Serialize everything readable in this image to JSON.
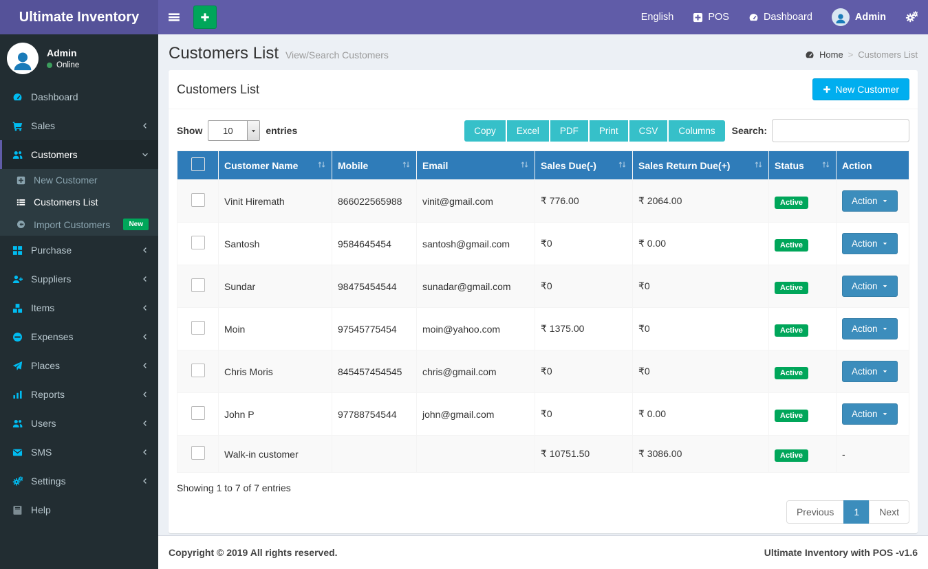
{
  "colors": {
    "navbar": "#605ca8",
    "brand_bg": "#555299",
    "sidebar": "#222d32",
    "icon_accent": "#00bcf1",
    "table_header": "#2f7cb9",
    "success_green": "#00a65a",
    "export_teal": "#36c0c9",
    "primary_blue": "#3c8dbc",
    "new_button_blue": "#00aeef",
    "page_bg": "#ecf0f5"
  },
  "navbar": {
    "brand": "Ultimate Inventory",
    "links": [
      {
        "label": "English",
        "icon": null
      },
      {
        "label": "POS",
        "icon": "plus-square"
      },
      {
        "label": "Dashboard",
        "icon": "tachometer"
      }
    ],
    "user": {
      "name": "Admin",
      "icon": "user"
    },
    "gear_icon": "cogs"
  },
  "sidebar": {
    "user": {
      "name": "Admin",
      "status": "Online"
    },
    "items": [
      {
        "label": "Dashboard",
        "icon": "tachometer"
      },
      {
        "label": "Sales",
        "icon": "cart",
        "arrow": "left"
      },
      {
        "label": "Customers",
        "icon": "users",
        "arrow": "down",
        "active": true,
        "submenu": [
          {
            "label": "New Customer",
            "icon": "plus-square"
          },
          {
            "label": "Customers List",
            "icon": "list",
            "active": true
          },
          {
            "label": "Import Customers",
            "icon": "arrow-circle-left",
            "badge": "New"
          }
        ]
      },
      {
        "label": "Purchase",
        "icon": "th-large",
        "arrow": "left"
      },
      {
        "label": "Suppliers",
        "icon": "user-plus",
        "arrow": "left"
      },
      {
        "label": "Items",
        "icon": "cubes",
        "arrow": "left"
      },
      {
        "label": "Expenses",
        "icon": "minus-circle",
        "arrow": "left"
      },
      {
        "label": "Places",
        "icon": "paper-plane",
        "arrow": "left"
      },
      {
        "label": "Reports",
        "icon": "bar-chart",
        "arrow": "left"
      },
      {
        "label": "Users",
        "icon": "users",
        "arrow": "left"
      },
      {
        "label": "SMS",
        "icon": "envelope",
        "arrow": "left"
      },
      {
        "label": "Settings",
        "icon": "cogs",
        "arrow": "left"
      },
      {
        "label": "Help",
        "icon": "book",
        "muted": true
      }
    ]
  },
  "content_header": {
    "title": "Customers List",
    "subtitle": "View/Search Customers",
    "breadcrumb": {
      "home": "Home",
      "home_icon": "tachometer",
      "separator": ">",
      "current": "Customers List"
    }
  },
  "panel": {
    "title": "Customers List",
    "new_button_label": "New Customer",
    "controls": {
      "show_label": "Show",
      "page_size": "10",
      "entries_label": "entries",
      "export_buttons": [
        "Copy",
        "Excel",
        "PDF",
        "Print",
        "CSV",
        "Columns"
      ],
      "search_label": "Search:",
      "search_value": ""
    },
    "table": {
      "columns": [
        {
          "label": "",
          "checkbox": true
        },
        {
          "label": "Customer Name",
          "sortable": true
        },
        {
          "label": "Mobile",
          "sortable": true
        },
        {
          "label": "Email",
          "sortable": true
        },
        {
          "label": "Sales Due(-)",
          "sortable": true
        },
        {
          "label": "Sales Return Due(+)",
          "sortable": true
        },
        {
          "label": "Status",
          "sortable": true
        },
        {
          "label": "Action",
          "sortable": false
        }
      ],
      "rows": [
        {
          "name": "Vinit Hiremath",
          "mobile": "866022565988",
          "email": "vinit@gmail.com",
          "sales_due": "₹ 776.00",
          "sales_return_due": "₹ 2064.00",
          "status": "Active",
          "action": "Action"
        },
        {
          "name": "Santosh",
          "mobile": "9584645454",
          "email": "santosh@gmail.com",
          "sales_due": "₹0",
          "sales_return_due": "₹ 0.00",
          "status": "Active",
          "action": "Action"
        },
        {
          "name": "Sundar",
          "mobile": "98475454544",
          "email": "sunadar@gmail.com",
          "sales_due": "₹0",
          "sales_return_due": "₹0",
          "status": "Active",
          "action": "Action"
        },
        {
          "name": "Moin",
          "mobile": "97545775454",
          "email": "moin@yahoo.com",
          "sales_due": "₹ 1375.00",
          "sales_return_due": "₹0",
          "status": "Active",
          "action": "Action"
        },
        {
          "name": "Chris Moris",
          "mobile": "845457454545",
          "email": "chris@gmail.com",
          "sales_due": "₹0",
          "sales_return_due": "₹0",
          "status": "Active",
          "action": "Action"
        },
        {
          "name": "John P",
          "mobile": "97788754544",
          "email": "john@gmail.com",
          "sales_due": "₹0",
          "sales_return_due": "₹ 0.00",
          "status": "Active",
          "action": "Action"
        },
        {
          "name": "Walk-in customer",
          "mobile": "",
          "email": "",
          "sales_due": "₹ 10751.50",
          "sales_return_due": "₹ 3086.00",
          "status": "Active",
          "action": "-"
        }
      ]
    },
    "summary": "Showing 1 to 7 of 7 entries",
    "pagination": {
      "previous": "Previous",
      "pages": [
        "1"
      ],
      "active": "1",
      "next": "Next"
    }
  },
  "footer": {
    "left": "Copyright © 2019 All rights reserved.",
    "right": "Ultimate Inventory with POS -v1.6"
  }
}
